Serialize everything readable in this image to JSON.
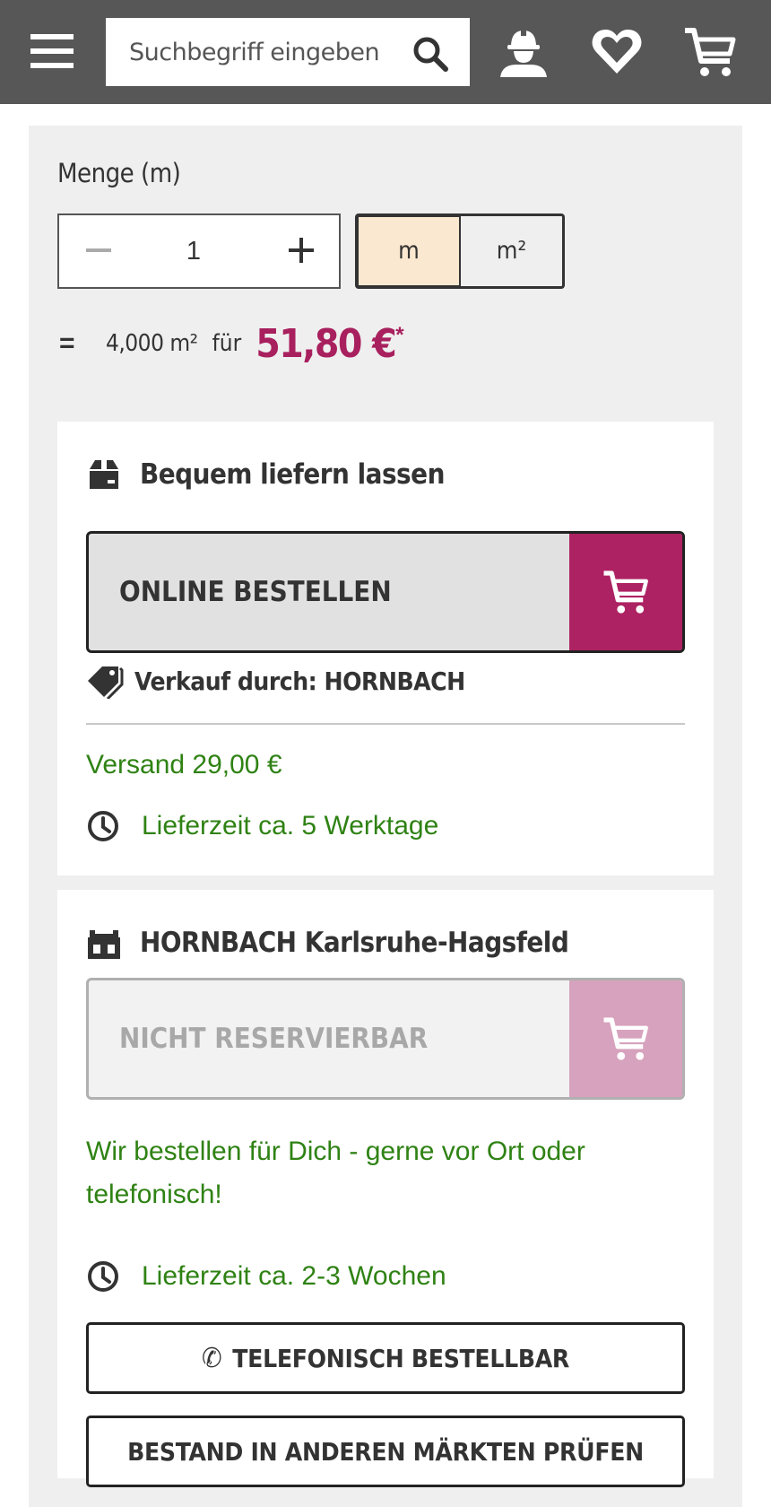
{
  "header": {
    "search_placeholder": "Suchbegriff eingeben",
    "icons": [
      "menu-icon",
      "search-icon",
      "account-icon",
      "wishlist-heart-icon",
      "cart-icon"
    ]
  },
  "quantity": {
    "label": "Menge (m)",
    "value": "1",
    "units": {
      "selected": "m",
      "other": "m²"
    },
    "equals": "=",
    "amount": "4,000 m²",
    "fuer": "für",
    "price": "51,80 €",
    "price_mark": "*"
  },
  "delivery": {
    "title": "Bequem liefern lassen",
    "button_label": "ONLINE BESTELLEN",
    "seller": "Verkauf durch: HORNBACH",
    "shipping": "Versand 29,00 €",
    "delivery_time": "Lieferzeit ca. 5 Werktage"
  },
  "store": {
    "title": "HORNBACH Karlsruhe-Hagsfeld",
    "button_label": "NICHT RESERVIERBAR",
    "info": "Wir bestellen für Dich - gerne vor Ort oder telefonisch!",
    "delivery_time": "Lieferzeit ca. 2-3 Wochen",
    "phone_button": "TELEFONISCH BESTELLBAR",
    "stock_button": "BESTAND IN ANDEREN MÄRKTEN PRÜFEN"
  },
  "colors": {
    "header_bg": "#575757",
    "accent": "#ad2262",
    "accent_disabled": "#d7a2bd",
    "price": "#a8205e",
    "success_green": "#2f8214",
    "unit_selected_bg": "#fbe8d0",
    "panel_bg": "#efefef"
  }
}
